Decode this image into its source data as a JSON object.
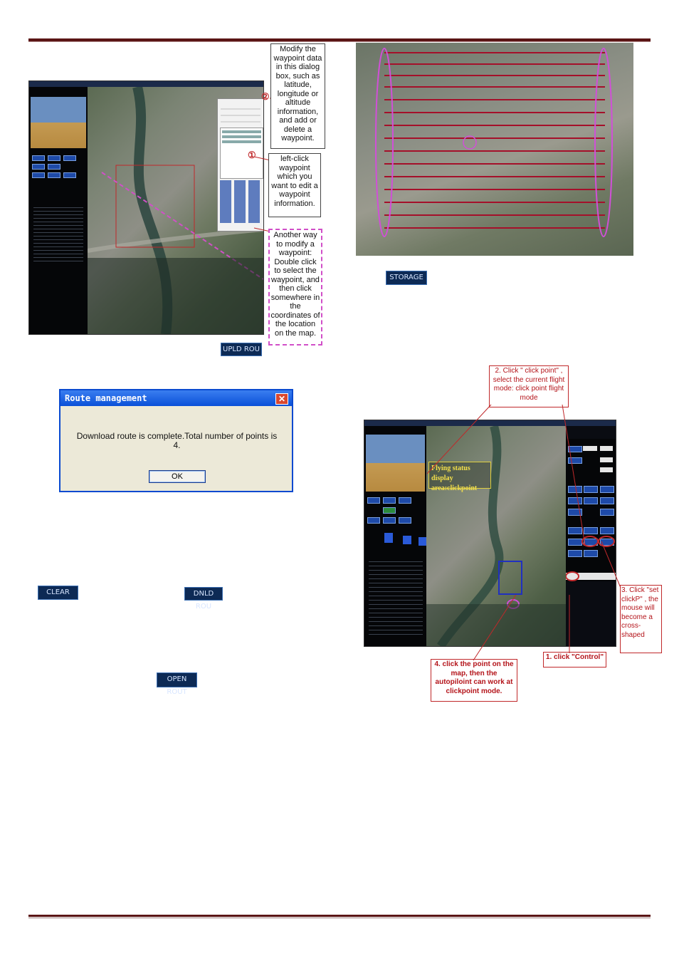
{
  "left": {
    "callout_modify": "Modify the waypoint data in this dialog box, such as latitude, longitude or altitude information, and add or delete a waypoint.",
    "callout_leftclick": "left-click waypoint which you want to edit a waypoint information.",
    "callout_another": "Another way to modify a waypoint: Double click to select the waypoint, and then click somewhere in the coordinates of the location on the map.",
    "marker_1": "①",
    "marker_2": "②",
    "upld_button": "UPLD ROU",
    "dialog": {
      "title": "Route management",
      "message": "Download route is complete.Total number of points is 4.",
      "ok": "OK",
      "close": "✕"
    },
    "clear_button": "CLEAR",
    "dnld_button": "DNLD ROU",
    "open_button": "OPEN ROUT"
  },
  "right": {
    "storage_button": "STORAGE",
    "callout_clickpoint": "2. Click \" click point\" , select the current flight mode: click point flight mode",
    "flying_status": "Flying status display area:clickpoint",
    "callout_setclickp": "3. Click \"set clickP\" , the mouse will become a cross-shaped",
    "callout_control": "1. click \"Control\"",
    "callout_clickmap": "4. click the point on the map, then the autopiloint can work at clickpoint mode."
  },
  "colors": {
    "rule": "#5a1414",
    "callout_red": "#b4141a",
    "dash_magenta": "#d14fc8",
    "dialog_blue": "#0a50d8",
    "button_navy": "#0d2a55"
  }
}
